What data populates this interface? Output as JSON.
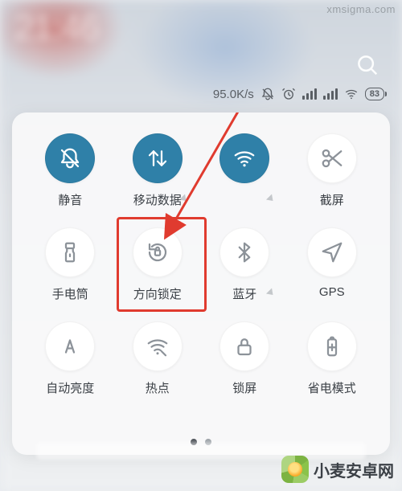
{
  "status": {
    "net_speed": "95.0K/s",
    "battery": "83"
  },
  "tiles": [
    {
      "id": "mute",
      "label": "静音",
      "state": "on"
    },
    {
      "id": "mobile-data",
      "label": "移动数据",
      "state": "on"
    },
    {
      "id": "wifi",
      "label": "",
      "state": "on"
    },
    {
      "id": "screenshot",
      "label": "截屏",
      "state": "off"
    },
    {
      "id": "flashlight",
      "label": "手电筒",
      "state": "off"
    },
    {
      "id": "rotation",
      "label": "方向锁定",
      "state": "off"
    },
    {
      "id": "bluetooth",
      "label": "蓝牙",
      "state": "off"
    },
    {
      "id": "gps",
      "label": "GPS",
      "state": "off"
    },
    {
      "id": "auto-bright",
      "label": "自动亮度",
      "state": "off"
    },
    {
      "id": "hotspot",
      "label": "热点",
      "state": "off"
    },
    {
      "id": "lock",
      "label": "锁屏",
      "state": "off"
    },
    {
      "id": "battery-save",
      "label": "省电模式",
      "state": "off"
    }
  ],
  "highlight_tile": "rotation",
  "pages": {
    "count": 2,
    "active": 0
  },
  "watermark": {
    "top": "xmsigma.com",
    "bottom": "小麦安卓网"
  }
}
